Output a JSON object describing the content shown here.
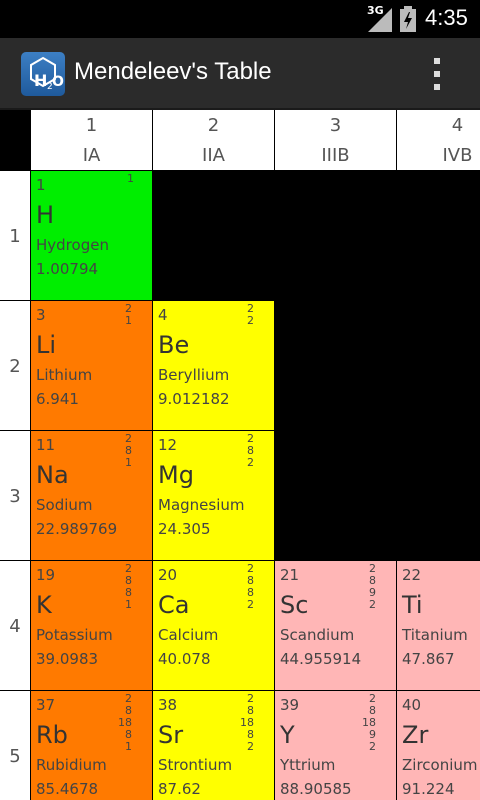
{
  "status_bar": {
    "network": "3G",
    "time": "4:35"
  },
  "action_bar": {
    "title": "Mendeleev's Table",
    "icon": "h2o-molecule-icon"
  },
  "columns": [
    {
      "number": "1",
      "group": "IA"
    },
    {
      "number": "2",
      "group": "IIA"
    },
    {
      "number": "3",
      "group": "IIIB"
    },
    {
      "number": "4",
      "group": "IVB"
    }
  ],
  "rows": [
    "1",
    "2",
    "3",
    "4",
    "5"
  ],
  "elements": [
    {
      "id": "h",
      "number": "1",
      "symbol": "H",
      "name": "Hydrogen",
      "mass": "1.00794",
      "shells": "1",
      "category": "nonmetal",
      "color": "#00ee00"
    },
    {
      "id": "li",
      "number": "3",
      "symbol": "Li",
      "name": "Lithium",
      "mass": "6.941",
      "shells": "2\n1",
      "category": "alkali",
      "color": "#ff7a00"
    },
    {
      "id": "be",
      "number": "4",
      "symbol": "Be",
      "name": "Beryllium",
      "mass": "9.012182",
      "shells": "2\n2",
      "category": "alkaline",
      "color": "#ffff00"
    },
    {
      "id": "na",
      "number": "11",
      "symbol": "Na",
      "name": "Sodium",
      "mass": "22.989769",
      "shells": "2\n8\n1",
      "category": "alkali",
      "color": "#ff7a00"
    },
    {
      "id": "mg",
      "number": "12",
      "symbol": "Mg",
      "name": "Magnesium",
      "mass": "24.305",
      "shells": "2\n8\n2",
      "category": "alkaline",
      "color": "#ffff00"
    },
    {
      "id": "k",
      "number": "19",
      "symbol": "K",
      "name": "Potassium",
      "mass": "39.0983",
      "shells": "2\n8\n8\n1",
      "category": "alkali",
      "color": "#ff7a00"
    },
    {
      "id": "ca",
      "number": "20",
      "symbol": "Ca",
      "name": "Calcium",
      "mass": "40.078",
      "shells": "2\n8\n8\n2",
      "category": "alkaline",
      "color": "#ffff00"
    },
    {
      "id": "sc",
      "number": "21",
      "symbol": "Sc",
      "name": "Scandium",
      "mass": "44.955914",
      "shells": "2\n8\n9\n2",
      "category": "transition",
      "color": "#ffb6b6"
    },
    {
      "id": "ti",
      "number": "22",
      "symbol": "Ti",
      "name": "Titanium",
      "mass": "47.867",
      "shells": "",
      "category": "transition",
      "color": "#ffb6b6"
    },
    {
      "id": "rb",
      "number": "37",
      "symbol": "Rb",
      "name": "Rubidium",
      "mass": "85.4678",
      "shells": "2\n8\n18\n8\n1",
      "category": "alkali",
      "color": "#ff7a00"
    },
    {
      "id": "sr",
      "number": "38",
      "symbol": "Sr",
      "name": "Strontium",
      "mass": "87.62",
      "shells": "2\n8\n18\n8\n2",
      "category": "alkaline",
      "color": "#ffff00"
    },
    {
      "id": "y",
      "number": "39",
      "symbol": "Y",
      "name": "Yttrium",
      "mass": "88.90585",
      "shells": "2\n8\n18\n9\n2",
      "category": "transition",
      "color": "#ffb6b6"
    },
    {
      "id": "zr",
      "number": "40",
      "symbol": "Zr",
      "name": "Zirconium",
      "mass": "91.224",
      "shells": "",
      "category": "transition",
      "color": "#ffb6b6"
    }
  ]
}
